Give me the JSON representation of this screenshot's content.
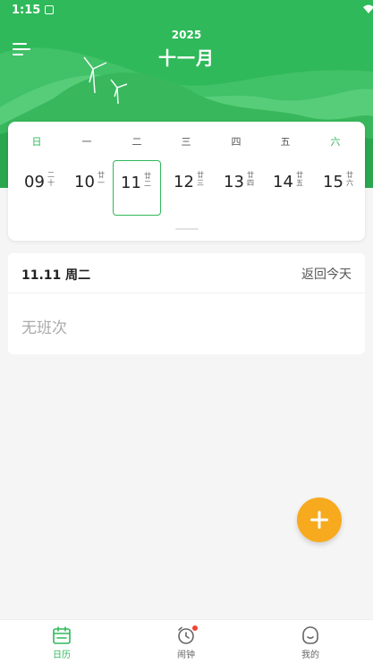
{
  "status_bar": {
    "time": "1:15"
  },
  "header": {
    "year": "2025",
    "month": "十一月"
  },
  "calendar": {
    "weekdays": [
      {
        "label": "日",
        "accent": true
      },
      {
        "label": "一",
        "accent": false
      },
      {
        "label": "二",
        "accent": false
      },
      {
        "label": "三",
        "accent": false
      },
      {
        "label": "四",
        "accent": false
      },
      {
        "label": "五",
        "accent": false
      },
      {
        "label": "六",
        "accent": true
      }
    ],
    "days": [
      {
        "num": "09",
        "lunar": "二十",
        "selected": false
      },
      {
        "num": "10",
        "lunar": "廿一",
        "selected": false
      },
      {
        "num": "11",
        "lunar": "廿二",
        "selected": true
      },
      {
        "num": "12",
        "lunar": "廿三",
        "selected": false
      },
      {
        "num": "13",
        "lunar": "廿四",
        "selected": false
      },
      {
        "num": "14",
        "lunar": "廿五",
        "selected": false
      },
      {
        "num": "15",
        "lunar": "廿六",
        "selected": false
      }
    ]
  },
  "schedule": {
    "date_label": "11.11 周二",
    "back_today": "返回今天",
    "empty_text": "无班次"
  },
  "bottom_nav": [
    {
      "label": "日历",
      "icon": "calendar-icon",
      "active": true
    },
    {
      "label": "闹钟",
      "icon": "alarm-icon",
      "active": false
    },
    {
      "label": "我的",
      "icon": "profile-icon",
      "active": false
    }
  ],
  "colors": {
    "primary": "#2fb95a",
    "fab": "#f7aa1d",
    "badge": "#f44336"
  }
}
